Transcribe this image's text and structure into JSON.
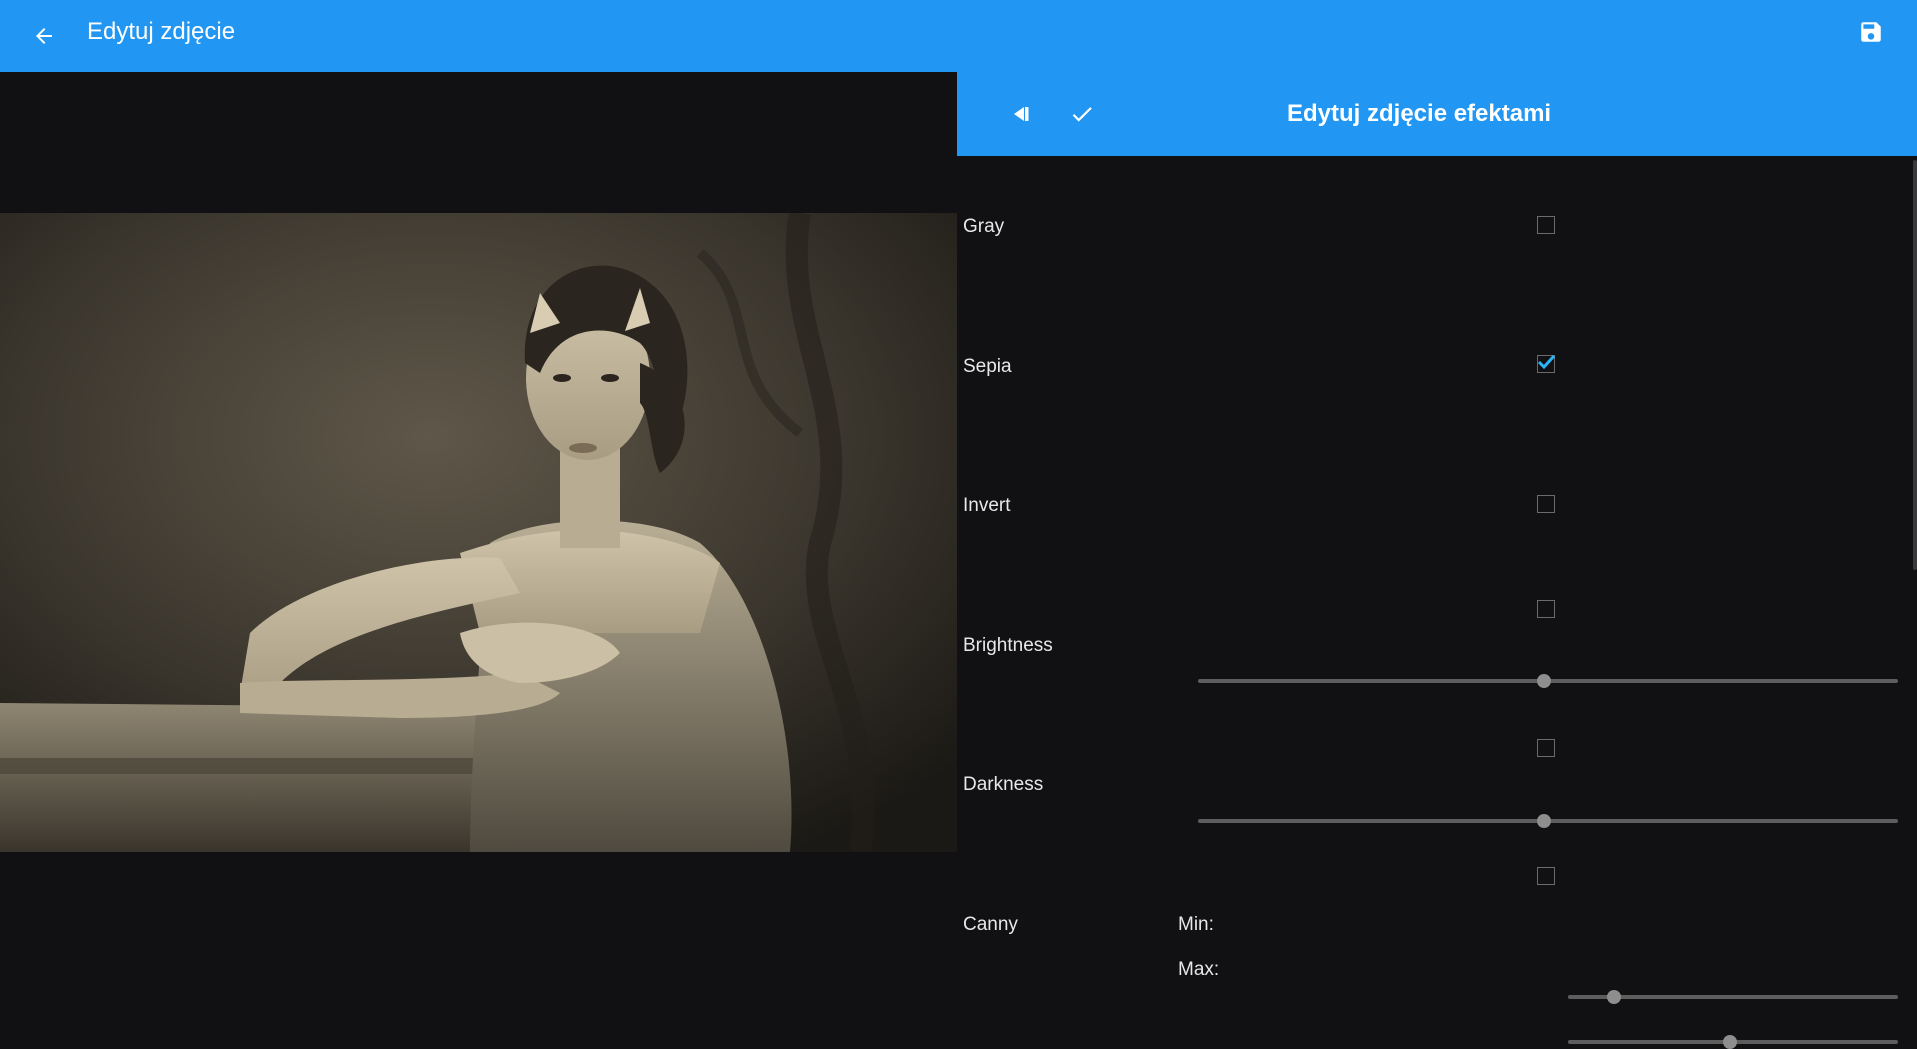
{
  "appbar": {
    "title": "Edytuj zdjęcie",
    "back_icon": "arrow-left-icon",
    "save_icon": "floppy-save-icon",
    "color": "#2196F3"
  },
  "panel": {
    "title": "Edytuj zdjęcie efektami",
    "toggle_icon": "collapse-panel-icon",
    "apply_icon": "check-icon",
    "effects": [
      {
        "label": "Gray",
        "checked": false
      },
      {
        "label": "Sepia",
        "checked": true
      },
      {
        "label": "Invert",
        "checked": false
      },
      {
        "label": "Brightness",
        "checked": false,
        "slider_value": 0.5
      },
      {
        "label": "Darkness",
        "checked": false,
        "slider_value": 0.5
      },
      {
        "label": "Canny",
        "checked": false,
        "min_label": "Min:",
        "min_value": 0.14,
        "max_label": "Max:",
        "max_value": 0.49
      }
    ],
    "checkbox_accent": "#29B6F6"
  },
  "photo": {
    "filter": "sepia"
  }
}
